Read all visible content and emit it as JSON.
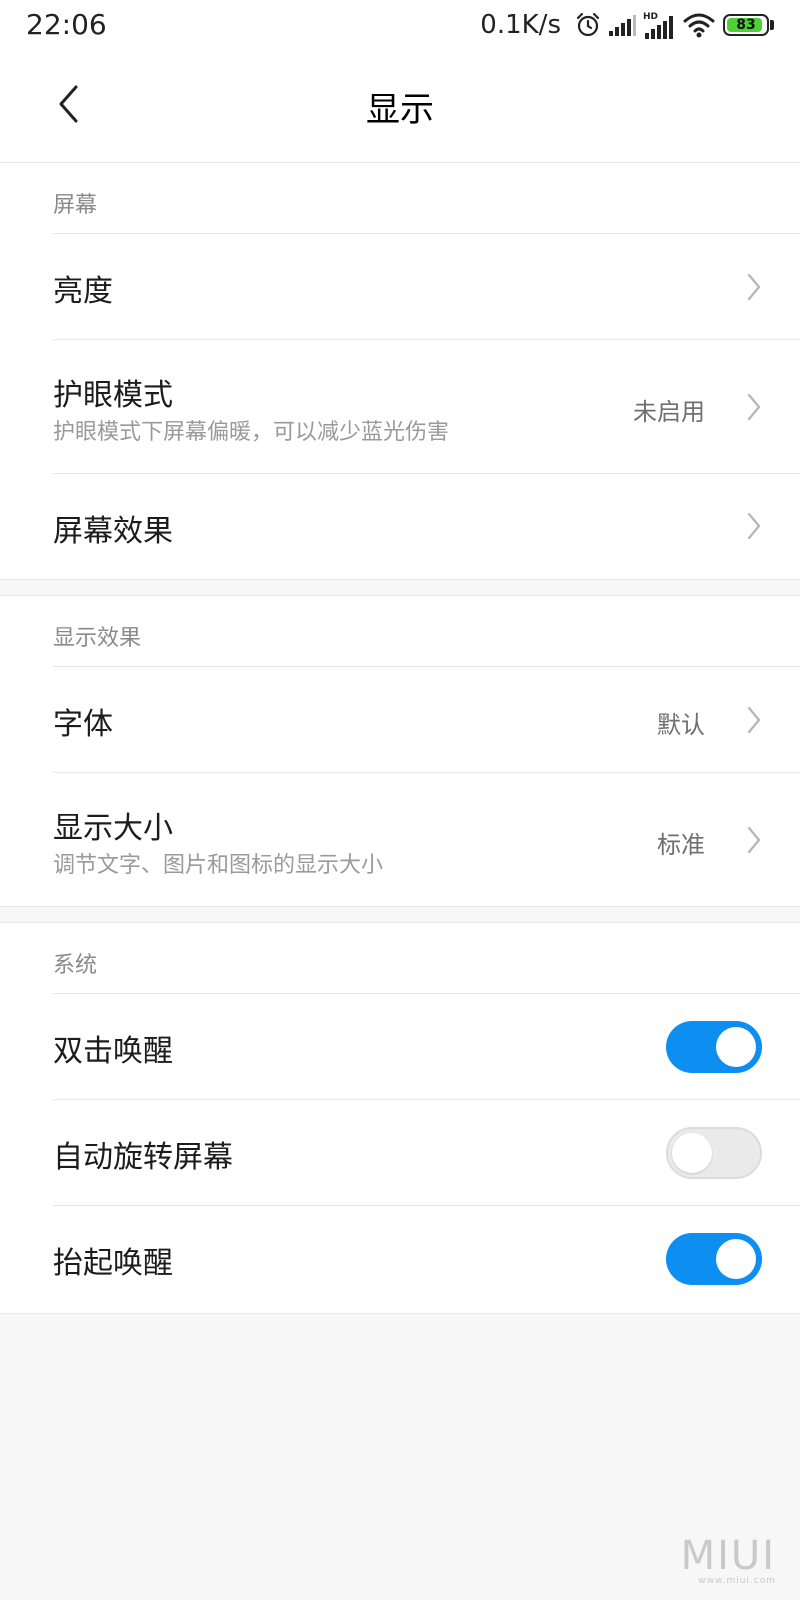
{
  "status_bar": {
    "time": "22:06",
    "net_speed": "0.1K/s",
    "battery_level": "83",
    "battery_color": "#4cd137"
  },
  "header": {
    "title": "显示",
    "back_icon": "chevron-left-icon"
  },
  "sections": {
    "screen": {
      "header": "屏幕",
      "brightness": {
        "title": "亮度"
      },
      "eye_comfort": {
        "title": "护眼模式",
        "subtitle": "护眼模式下屏幕偏暖，可以减少蓝光伤害",
        "value": "未启用"
      },
      "screen_effect": {
        "title": "屏幕效果"
      }
    },
    "display_effect": {
      "header": "显示效果",
      "font": {
        "title": "字体",
        "value": "默认"
      },
      "display_size": {
        "title": "显示大小",
        "subtitle": "调节文字、图片和图标的显示大小",
        "value": "标准"
      }
    },
    "system": {
      "header": "系统",
      "double_tap_wake": {
        "title": "双击唤醒",
        "enabled": true
      },
      "auto_rotate": {
        "title": "自动旋转屏幕",
        "enabled": false
      },
      "lift_to_wake": {
        "title": "抬起唤醒",
        "enabled": true
      }
    }
  },
  "accent_color": "#0d8ff2",
  "watermark": {
    "logo": "MIUI",
    "site": "www.miui.com"
  }
}
